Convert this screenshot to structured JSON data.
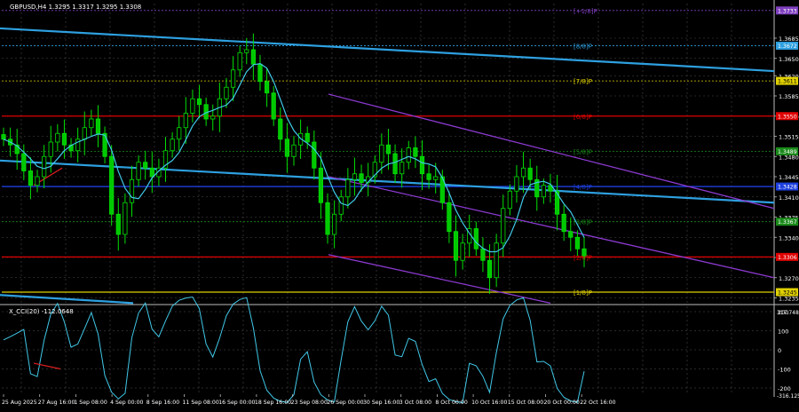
{
  "header": {
    "symbol_text": "GBPUSD,H4 1.3295 1.3317 1.3295 1.3308"
  },
  "indicator": {
    "label": "X_CCI(20) -112.0648",
    "max_label": "317.7484",
    "min_label": "-316.1259",
    "levels": [
      {
        "value": 200,
        "label": "200"
      },
      {
        "value": 100,
        "label": "100"
      },
      {
        "value": 0,
        "label": "0"
      },
      {
        "value": -100,
        "label": "-100"
      },
      {
        "value": -200,
        "label": "-200"
      }
    ]
  },
  "price_axis": {
    "labels": [
      "1.3685",
      "1.3650",
      "1.3620",
      "1.3585",
      "1.3550",
      "1.3515",
      "1.3480",
      "1.3445",
      "1.3410",
      "1.3375",
      "1.3340",
      "1.3305",
      "1.3270",
      "1.3235"
    ]
  },
  "price_markers": [
    {
      "price": 1.3733,
      "text": "1.3733",
      "color": "#7f3fbf",
      "textColor": "#ffffff"
    },
    {
      "price": 1.3672,
      "text": "1.3672",
      "color": "#2ea0e0",
      "textColor": "#ffffff"
    },
    {
      "price": 1.3611,
      "text": "1.3611",
      "color": "#e0d000",
      "textColor": "#000000"
    },
    {
      "price": 1.355,
      "text": "1.3550",
      "color": "#e00000",
      "textColor": "#ffffff"
    },
    {
      "price": 1.3489,
      "text": "1.3489",
      "color": "#1a8a1a",
      "textColor": "#ffffff"
    },
    {
      "price": 1.3428,
      "text": "1.3428",
      "color": "#1d3fe0",
      "textColor": "#ffffff"
    },
    {
      "price": 1.3367,
      "text": "1.3367",
      "color": "#1a8a1a",
      "textColor": "#ffffff"
    },
    {
      "price": 1.3306,
      "text": "1.3306",
      "color": "#e00000",
      "textColor": "#ffffff"
    },
    {
      "price": 1.3245,
      "text": "1.3245",
      "color": "#e0d000",
      "textColor": "#000000"
    }
  ],
  "murray_levels": [
    {
      "price": 1.3733,
      "label": "[+1/8]P",
      "color": "#7f3fbf",
      "dash": true
    },
    {
      "price": 1.3672,
      "label": "[8/8]P",
      "color": "#2ea0e0",
      "dash": true
    },
    {
      "price": 1.3611,
      "label": "[7/8]P",
      "color": "#e0d000",
      "dash": true
    },
    {
      "price": 1.355,
      "label": "[6/8]P",
      "color": "#e00000",
      "dash": false
    },
    {
      "price": 1.3489,
      "label": "[5/8]P",
      "color": "#1a8a1a",
      "dash": true
    },
    {
      "price": 1.3428,
      "label": "[4/8]P",
      "color": "#1d3fe0",
      "dash": false
    },
    {
      "price": 1.3367,
      "label": "[3/8]P",
      "color": "#1a8a1a",
      "dash": true
    },
    {
      "price": 1.3306,
      "label": "[2/8]P",
      "color": "#e00000",
      "dash": false
    },
    {
      "price": 1.3245,
      "label": "[1/8]P",
      "color": "#e0d000",
      "dash": false
    }
  ],
  "time_axis": {
    "labels": [
      "25 Aug 2025",
      "27 Aug 16:00",
      "1 Sep 08:00",
      "4 Sep 00:00",
      "8 Sep 16:00",
      "11 Sep 08:00",
      "16 Sep 00:00",
      "18 Sep 16:00",
      "23 Sep 08:00",
      "26 Sep 00:00",
      "30 Sep 16:00",
      "3 Oct 08:00",
      "8 Oct 00:00",
      "10 Oct 16:00",
      "15 Oct 08:00",
      "20 Oct 00:00",
      "22 Oct 16:00"
    ]
  },
  "chart_data": {
    "type": "line",
    "title": "GBPUSD,H4 1.3295 1.3317 1.3295 1.3308",
    "xlabel": "",
    "ylabel": "",
    "ylim": [
      1.3225,
      1.3745
    ],
    "grid": true,
    "series": [
      {
        "type": "candlestick-closes",
        "values": [
          1.351,
          1.35,
          1.3485,
          1.3455,
          1.343,
          1.3445,
          1.348,
          1.3505,
          1.352,
          1.35,
          1.349,
          1.351,
          1.353,
          1.3545,
          1.352,
          1.348,
          1.338,
          1.3345,
          1.34,
          1.344,
          1.347,
          1.346,
          1.3445,
          1.346,
          1.349,
          1.351,
          1.353,
          1.3555,
          1.358,
          1.357,
          1.3545,
          1.355,
          1.358,
          1.36,
          1.363,
          1.366,
          1.3665,
          1.364,
          1.361,
          1.359,
          1.3545,
          1.351,
          1.348,
          1.35,
          1.352,
          1.3505,
          1.346,
          1.34,
          1.3345,
          1.338,
          1.341,
          1.344,
          1.345,
          1.3435,
          1.3445,
          1.347,
          1.35,
          1.3485,
          1.345,
          1.347,
          1.3495,
          1.348,
          1.345,
          1.344,
          1.3445,
          1.34,
          1.335,
          1.33,
          1.333,
          1.3355,
          1.332,
          1.33,
          1.327,
          1.333,
          1.339,
          1.342,
          1.3445,
          1.346,
          1.344,
          1.341,
          1.343,
          1.342,
          1.338,
          1.335,
          1.334,
          1.332,
          1.3308
        ]
      },
      {
        "name": "",
        "type": "moving-average"
      },
      {
        "name": "X_CCI(20)",
        "type": "oscillator",
        "last_value": -112.0648
      }
    ]
  }
}
